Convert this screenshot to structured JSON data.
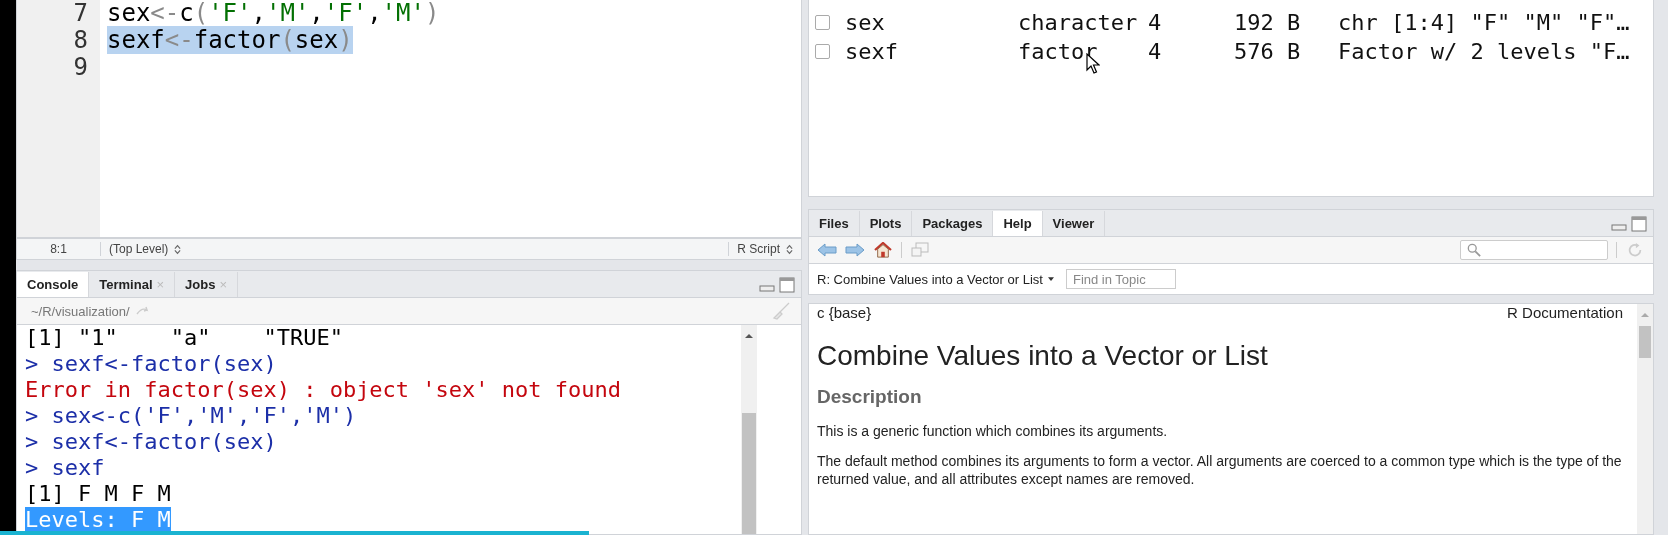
{
  "editor": {
    "lines": [
      {
        "number": "7",
        "selected": false,
        "tokens": [
          {
            "kind": "ident",
            "text": "sex"
          },
          {
            "kind": "op",
            "text": "<-"
          },
          {
            "kind": "ident",
            "text": "c"
          },
          {
            "kind": "paren",
            "text": "("
          },
          {
            "kind": "string",
            "text": "'F'"
          },
          {
            "kind": "ident",
            "text": ","
          },
          {
            "kind": "string",
            "text": "'M'"
          },
          {
            "kind": "ident",
            "text": ","
          },
          {
            "kind": "string",
            "text": "'F'"
          },
          {
            "kind": "ident",
            "text": ","
          },
          {
            "kind": "string",
            "text": "'M'"
          },
          {
            "kind": "paren",
            "text": ")"
          }
        ]
      },
      {
        "number": "8",
        "selected": true,
        "tokens": [
          {
            "kind": "ident",
            "text": "sexf"
          },
          {
            "kind": "op",
            "text": "<-"
          },
          {
            "kind": "ident",
            "text": "factor"
          },
          {
            "kind": "paren",
            "text": "("
          },
          {
            "kind": "ident",
            "text": "sex"
          },
          {
            "kind": "paren",
            "text": ")"
          }
        ]
      },
      {
        "number": "9",
        "selected": false
      }
    ],
    "status_bar": {
      "position": "8:1",
      "scope": "(Top Level)",
      "file_type": "R Script"
    }
  },
  "console": {
    "tabs": [
      {
        "label": "Console",
        "selected": true,
        "closable": false
      },
      {
        "label": "Terminal",
        "selected": false,
        "closable": true
      },
      {
        "label": "Jobs",
        "selected": false,
        "closable": true
      }
    ],
    "close_glyph": "×",
    "path": "~/R/visualization/",
    "lines": [
      {
        "kind": "output",
        "text": "[1] \"1\"    \"a\"    \"TRUE\"",
        "selected": false
      },
      {
        "kind": "command",
        "text": "> sexf<-factor(sex)",
        "selected": false
      },
      {
        "kind": "error",
        "text": "Error in factor(sex) : object 'sex' not found",
        "selected": false
      },
      {
        "kind": "command",
        "text": "> sex<-c('F','M','F','M')",
        "selected": false
      },
      {
        "kind": "command",
        "text": "> sexf<-factor(sex)",
        "selected": false
      },
      {
        "kind": "command",
        "text": "> sexf",
        "selected": false
      },
      {
        "kind": "output",
        "text": "[1] F M F M",
        "selected": false
      },
      {
        "kind": "output",
        "text": "Levels: F M",
        "selected": true
      }
    ]
  },
  "environment": {
    "rows": [
      {
        "checked": false,
        "name": "sex",
        "type": "character",
        "length": "4",
        "size": "192 B",
        "value": "chr [1:4] \"F\" \"M\" \"F\"…"
      },
      {
        "checked": false,
        "name": "sexf",
        "type": "factor",
        "length": "4",
        "size": "576 B",
        "value": "Factor w/ 2 levels \"F…"
      }
    ]
  },
  "help": {
    "tabs": [
      {
        "label": "Files",
        "selected": false
      },
      {
        "label": "Plots",
        "selected": false
      },
      {
        "label": "Packages",
        "selected": false
      },
      {
        "label": "Help",
        "selected": true
      },
      {
        "label": "Viewer",
        "selected": false
      }
    ],
    "topic": "R: Combine Values into a Vector or List",
    "find_placeholder": "Find in Topic",
    "doc": {
      "name": "c {base}",
      "source": "R Documentation",
      "title": "Combine Values into a Vector or List",
      "section": "Description",
      "paragraphs": [
        "This is a generic function which combines its arguments.",
        "The default method combines its arguments to form a vector. All arguments are coerced to a common type which is the type of the returned value, and all attributes except names are removed."
      ]
    }
  },
  "video_progress": {
    "level": 0.353
  }
}
